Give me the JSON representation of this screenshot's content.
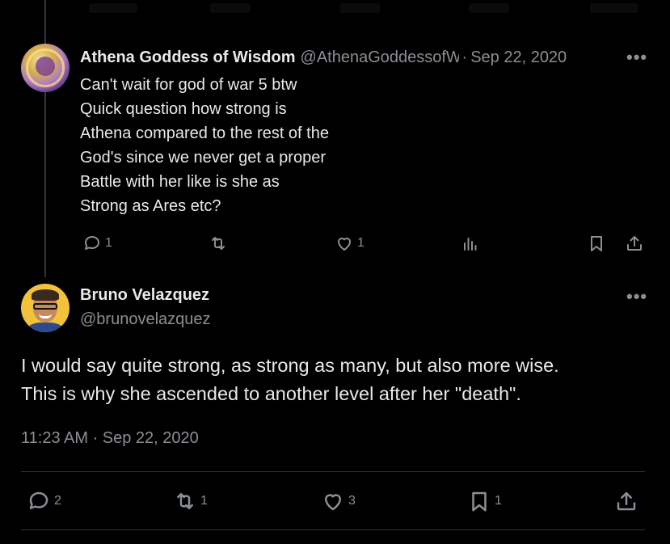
{
  "parent_tweet": {
    "author_name": "Athena Goddess of Wisdom",
    "handle": "@AthenaGoddessofWisdom",
    "separator": "·",
    "date": "Sep 22, 2020",
    "more_label": "•••",
    "text_lines": [
      "Can't wait for god of war 5 btw",
      "Quick question how strong is",
      "Athena compared to the rest of the",
      "God's since we never get a proper",
      "Battle with her like is she as",
      "Strong as Ares etc?"
    ],
    "actions": {
      "replies": "1",
      "retweets": "",
      "likes": "1",
      "views": ""
    }
  },
  "main_tweet": {
    "author_name": "Bruno Velazquez",
    "handle": "@brunovelazquez",
    "more_label": "•••",
    "text_lines": [
      "I would say quite strong, as strong as many, but also more wise.",
      "This is why she ascended to another level after her \"death\"."
    ],
    "timestamp": "11:23 AM · Sep 22, 2020",
    "actions": {
      "replies": "2",
      "retweets": "1",
      "likes": "3",
      "bookmarks": "1"
    }
  },
  "colors": {
    "background": "#000000",
    "text_primary": "#e7e9ea",
    "text_secondary": "#8b8f94",
    "divider": "#2f3336",
    "avatar_bruno_bg": "#f3c23b"
  },
  "icons": {
    "reply": "speech-bubble-icon",
    "retweet": "retweet-arrows-icon",
    "like": "heart-icon",
    "views": "bar-chart-icon",
    "bookmark": "bookmark-icon",
    "share": "share-upload-icon",
    "more": "more-dots-icon"
  }
}
